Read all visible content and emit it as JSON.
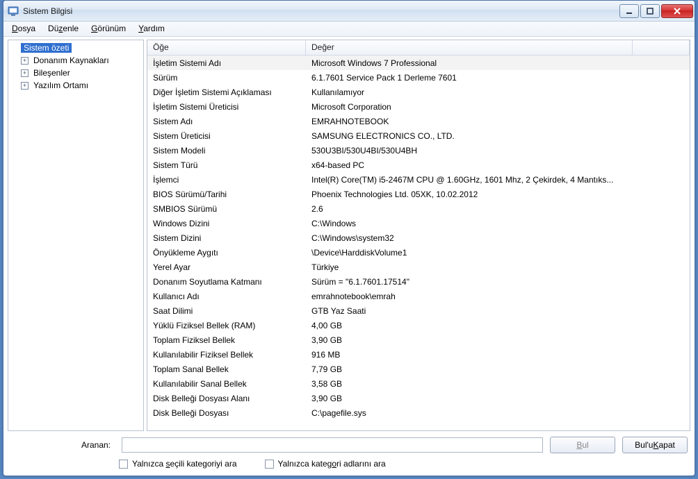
{
  "window": {
    "title": "Sistem Bilgisi"
  },
  "menu": {
    "items": [
      {
        "pre": "",
        "ul": "D",
        "post": "osya"
      },
      {
        "pre": "Dü",
        "ul": "z",
        "post": "enle"
      },
      {
        "pre": "",
        "ul": "G",
        "post": "örünüm"
      },
      {
        "pre": "",
        "ul": "Y",
        "post": "ardım"
      }
    ]
  },
  "tree": {
    "root": "Sistem özeti",
    "children": [
      "Donanım Kaynakları",
      "Bileşenler",
      "Yazılım Ortamı"
    ]
  },
  "grid": {
    "headers": {
      "c1": "Öğe",
      "c2": "Değer"
    },
    "rows": [
      {
        "k": "İşletim Sistemi Adı",
        "v": "Microsoft Windows 7 Professional"
      },
      {
        "k": "Sürüm",
        "v": "6.1.7601 Service Pack 1 Derleme 7601"
      },
      {
        "k": "Diğer İşletim Sistemi Açıklaması",
        "v": "Kullanılamıyor"
      },
      {
        "k": "İşletim Sistemi Üreticisi",
        "v": "Microsoft Corporation"
      },
      {
        "k": "Sistem Adı",
        "v": "EMRAHNOTEBOOK"
      },
      {
        "k": "Sistem Üreticisi",
        "v": "SAMSUNG ELECTRONICS CO., LTD."
      },
      {
        "k": "Sistem Modeli",
        "v": "530U3BI/530U4BI/530U4BH"
      },
      {
        "k": "Sistem Türü",
        "v": "x64-based PC"
      },
      {
        "k": "İşlemci",
        "v": "Intel(R) Core(TM) i5-2467M CPU @ 1.60GHz, 1601 Mhz, 2 Çekirdek, 4 Mantıks..."
      },
      {
        "k": "BIOS Sürümü/Tarihi",
        "v": "Phoenix Technologies Ltd. 05XK, 10.02.2012"
      },
      {
        "k": "SMBIOS Sürümü",
        "v": "2.6"
      },
      {
        "k": "Windows Dizini",
        "v": "C:\\Windows"
      },
      {
        "k": "Sistem Dizini",
        "v": "C:\\Windows\\system32"
      },
      {
        "k": "Önyükleme Aygıtı",
        "v": "\\Device\\HarddiskVolume1"
      },
      {
        "k": "Yerel Ayar",
        "v": "Türkiye"
      },
      {
        "k": "Donanım Soyutlama Katmanı",
        "v": "Sürüm = \"6.1.7601.17514\""
      },
      {
        "k": "Kullanıcı Adı",
        "v": "emrahnotebook\\emrah"
      },
      {
        "k": "Saat Dilimi",
        "v": "GTB Yaz Saati"
      },
      {
        "k": "Yüklü Fiziksel Bellek (RAM)",
        "v": "4,00 GB"
      },
      {
        "k": "Toplam Fiziksel Bellek",
        "v": "3,90 GB"
      },
      {
        "k": "Kullanılabilir Fiziksel Bellek",
        "v": "916 MB"
      },
      {
        "k": "Toplam Sanal Bellek",
        "v": "7,79 GB"
      },
      {
        "k": "Kullanılabilir Sanal Bellek",
        "v": "3,58 GB"
      },
      {
        "k": "Disk Belleği Dosyası Alanı",
        "v": "3,90 GB"
      },
      {
        "k": "Disk Belleği Dosyası",
        "v": "C:\\pagefile.sys"
      }
    ]
  },
  "search": {
    "label": "Aranan:",
    "placeholder": "",
    "find_pre": "",
    "find_ul": "B",
    "find_post": "ul",
    "close_pre": "Bul'u ",
    "close_ul": "K",
    "close_post": "apat",
    "check1_pre": "Yalnızca ",
    "check1_ul": "s",
    "check1_post": "eçili kategoriyi ara",
    "check2_pre": "Yalnızca kateg",
    "check2_ul": "o",
    "check2_post": "ri adlarını ara"
  }
}
